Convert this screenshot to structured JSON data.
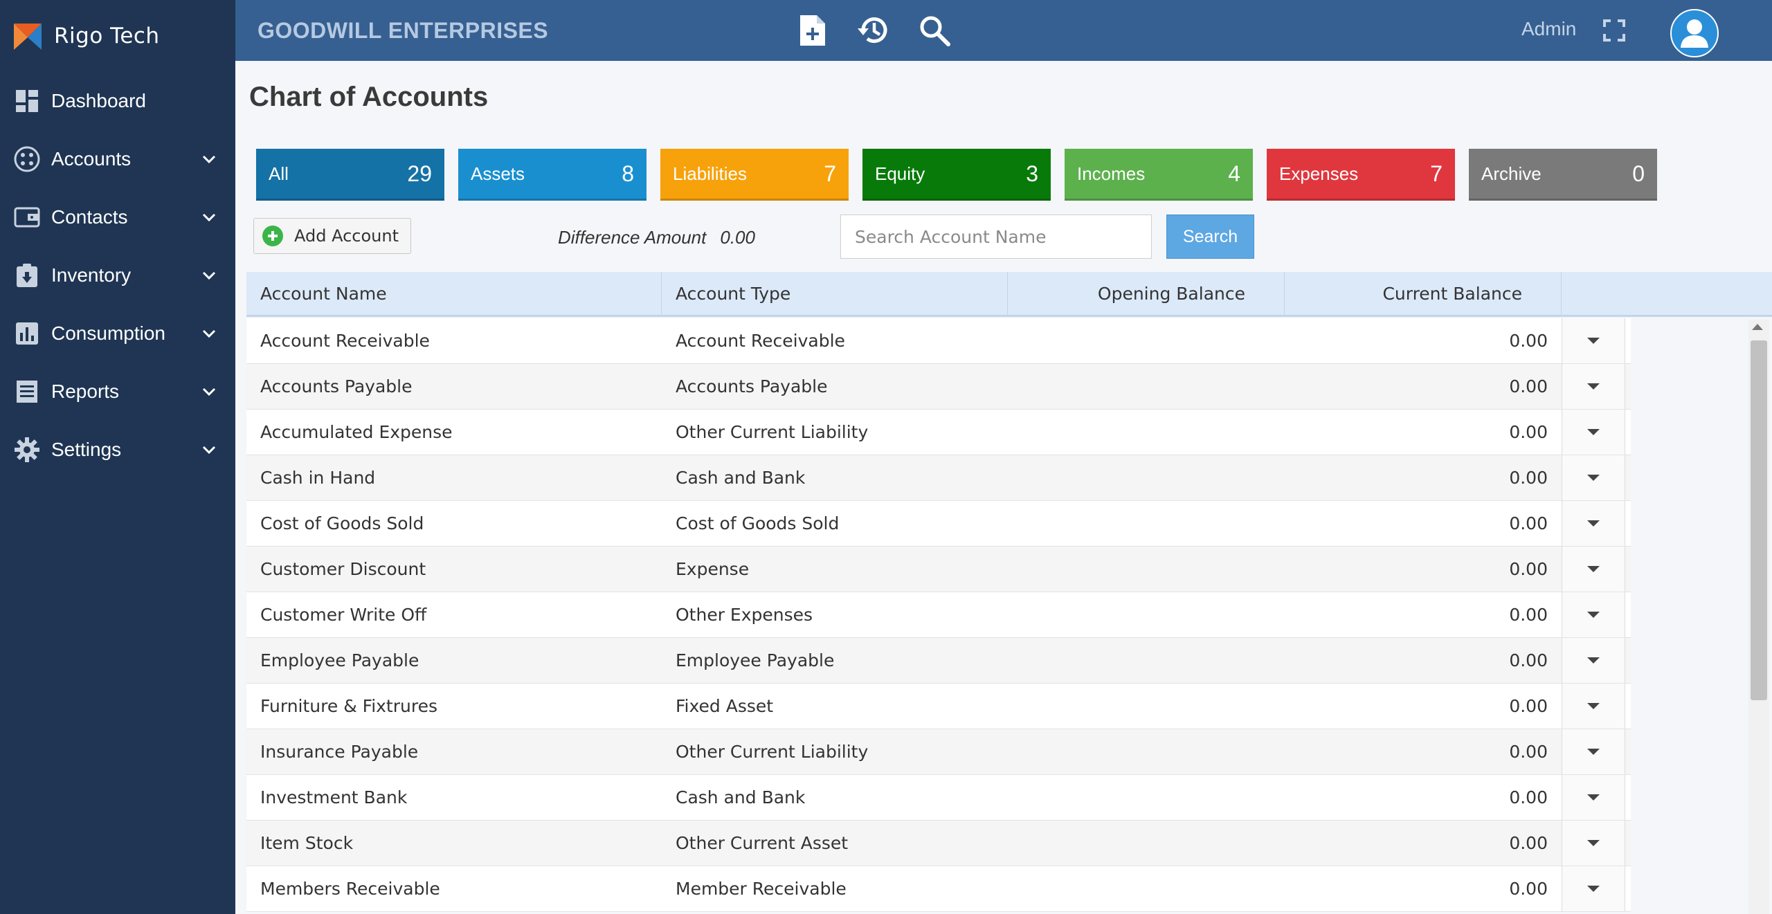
{
  "brand": {
    "name": "Rigo Tech"
  },
  "sidebar": {
    "items": [
      {
        "label": "Dashboard",
        "icon": "dashboard-icon",
        "has_children": false
      },
      {
        "label": "Accounts",
        "icon": "accounts-icon",
        "has_children": true
      },
      {
        "label": "Contacts",
        "icon": "contacts-icon",
        "has_children": true
      },
      {
        "label": "Inventory",
        "icon": "inventory-icon",
        "has_children": true
      },
      {
        "label": "Consumption",
        "icon": "consumption-icon",
        "has_children": true
      },
      {
        "label": "Reports",
        "icon": "reports-icon",
        "has_children": true
      },
      {
        "label": "Settings",
        "icon": "gear-icon",
        "has_children": true
      }
    ]
  },
  "header": {
    "company": "GOODWILL ENTERPRISES",
    "user": "Admin",
    "icons": [
      "new-document-icon",
      "history-icon",
      "search-icon",
      "fullscreen-icon",
      "user-avatar-icon"
    ]
  },
  "page": {
    "title": "Chart of Accounts"
  },
  "categories": [
    {
      "label": "All",
      "count": "29",
      "color": "#1472a6"
    },
    {
      "label": "Assets",
      "count": "8",
      "color": "#1a8fd0"
    },
    {
      "label": "Liabilities",
      "count": "7",
      "color": "#f7a20b"
    },
    {
      "label": "Equity",
      "count": "3",
      "color": "#087a0a"
    },
    {
      "label": "Incomes",
      "count": "4",
      "color": "#5cb14d"
    },
    {
      "label": "Expenses",
      "count": "7",
      "color": "#e0373f"
    },
    {
      "label": "Archive",
      "count": "0",
      "color": "#7a7a7a"
    }
  ],
  "toolbar": {
    "add_label": "Add Account",
    "difference_label": "Difference Amount",
    "difference_value": "0.00",
    "search_placeholder": "Search Account Name",
    "search_label": "Search"
  },
  "table": {
    "columns": [
      "Account Name",
      "Account Type",
      "Opening Balance",
      "Current Balance"
    ],
    "rows": [
      {
        "name": "Account Receivable",
        "type": "Account Receivable",
        "opening": "",
        "current": "0.00"
      },
      {
        "name": "Accounts Payable",
        "type": "Accounts Payable",
        "opening": "",
        "current": "0.00"
      },
      {
        "name": "Accumulated Expense",
        "type": "Other Current Liability",
        "opening": "",
        "current": "0.00"
      },
      {
        "name": "Cash in Hand",
        "type": "Cash and Bank",
        "opening": "",
        "current": "0.00"
      },
      {
        "name": "Cost of Goods Sold",
        "type": "Cost of Goods Sold",
        "opening": "",
        "current": "0.00"
      },
      {
        "name": "Customer Discount",
        "type": "Expense",
        "opening": "",
        "current": "0.00"
      },
      {
        "name": "Customer Write Off",
        "type": "Other Expenses",
        "opening": "",
        "current": "0.00"
      },
      {
        "name": "Employee Payable",
        "type": "Employee Payable",
        "opening": "",
        "current": "0.00"
      },
      {
        "name": "Furniture & Fixtrures",
        "type": "Fixed Asset",
        "opening": "",
        "current": "0.00"
      },
      {
        "name": "Insurance Payable",
        "type": "Other Current Liability",
        "opening": "",
        "current": "0.00"
      },
      {
        "name": "Investment Bank",
        "type": "Cash and Bank",
        "opening": "",
        "current": "0.00"
      },
      {
        "name": "Item Stock",
        "type": "Other Current Asset",
        "opening": "",
        "current": "0.00"
      },
      {
        "name": "Members Receivable",
        "type": "Member Receivable",
        "opening": "",
        "current": "0.00"
      }
    ]
  }
}
